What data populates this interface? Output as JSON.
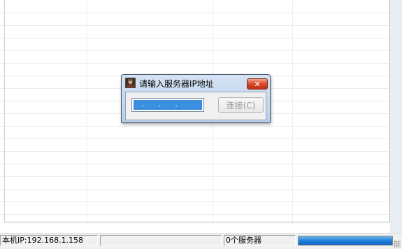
{
  "dialog": {
    "title": "请输入服务器IP地址",
    "ip_input": {
      "value": " .   .   . "
    },
    "connect_button": {
      "label": "连接(C)",
      "enabled": false
    },
    "close_button": {
      "symbol": "✕"
    },
    "icon": "app-character-icon"
  },
  "status_bar": {
    "local_ip": "本机IP:192.168.1.158",
    "message": "",
    "server_count": "0个服务器",
    "progress": 1.0,
    "progress_color": "#1c7ed6"
  },
  "colors": {
    "close_button": "#d9492c",
    "selection": "#3a8fe0"
  }
}
